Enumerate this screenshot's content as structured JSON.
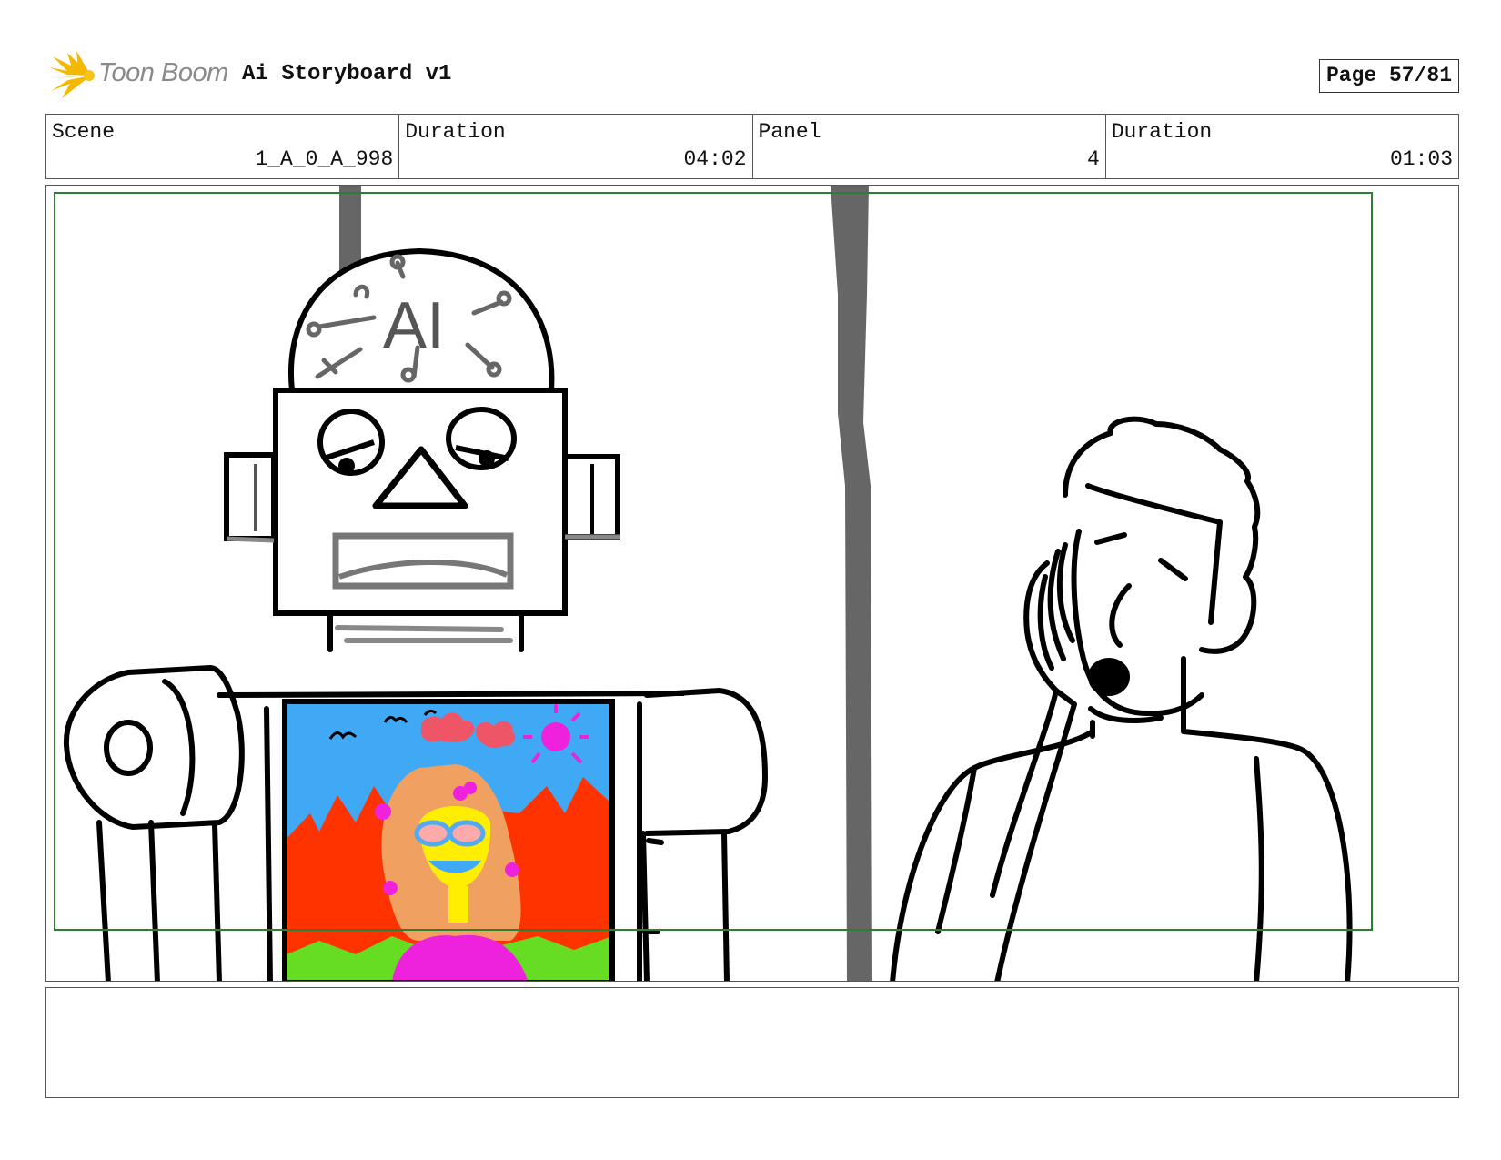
{
  "header": {
    "logo_text": "Toon Boom",
    "title": "Ai Storyboard v1",
    "page_label": "Page 57/81"
  },
  "info": {
    "scene_label": "Scene",
    "scene_value": "1_A_0_A_998",
    "scene_duration_label": "Duration",
    "scene_duration_value": "04:02",
    "panel_label": "Panel",
    "panel_value": "4",
    "panel_duration_label": "Duration",
    "panel_duration_value": "01:03"
  },
  "panel": {
    "robot_head_text": "AI",
    "colors": {
      "safe_frame": "#2e7d32",
      "sky": "#3fa9f5",
      "fire": "#ff3300",
      "grass": "#66dd22",
      "magenta": "#ee22dd",
      "yellow": "#ffee00",
      "hair": "#f0a060",
      "glasses": "#55aaee",
      "pink": "#ff6677",
      "pillar": "#666666"
    }
  },
  "notes": {
    "text": ""
  }
}
